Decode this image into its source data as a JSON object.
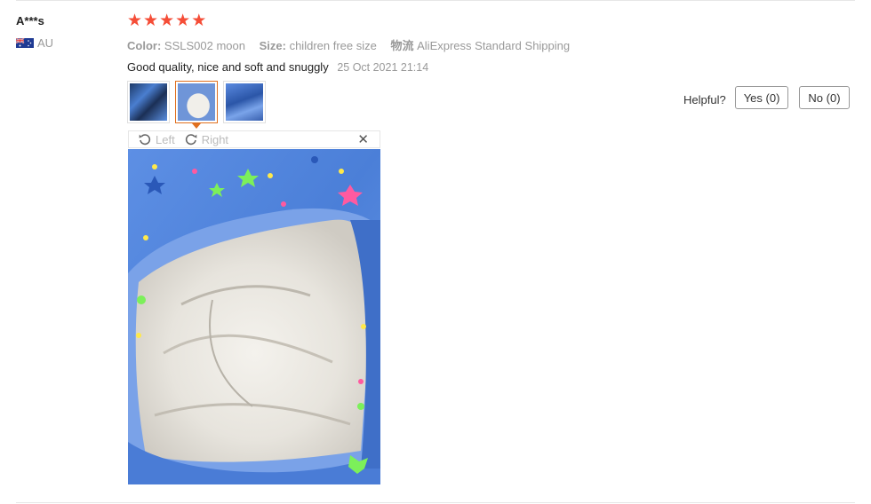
{
  "reviewer": {
    "name": "A***s",
    "country": "AU",
    "flag_icon": "australia-flag-icon"
  },
  "rating": {
    "stars": 5,
    "max": 5,
    "color": "#f54d37"
  },
  "attributes": [
    {
      "key": "Color:",
      "value": "SSLS002 moon"
    },
    {
      "key": "Size:",
      "value": "children free size"
    },
    {
      "key": "物流",
      "value": "AliExpress Standard Shipping"
    }
  ],
  "review": {
    "text": "Good quality, nice and soft and snuggly",
    "date": "25 Oct 2021 21:14"
  },
  "thumbnails": [
    {
      "name": "review-photo-1",
      "selected": false
    },
    {
      "name": "review-photo-2",
      "selected": true
    },
    {
      "name": "review-photo-3",
      "selected": false
    }
  ],
  "viewer": {
    "rotate_left_label": "Left",
    "rotate_right_label": "Right",
    "close_icon": "close-icon",
    "accent": "#e07020"
  },
  "helpful": {
    "label": "Helpful?",
    "yes_label": "Yes (0)",
    "no_label": "No (0)"
  }
}
